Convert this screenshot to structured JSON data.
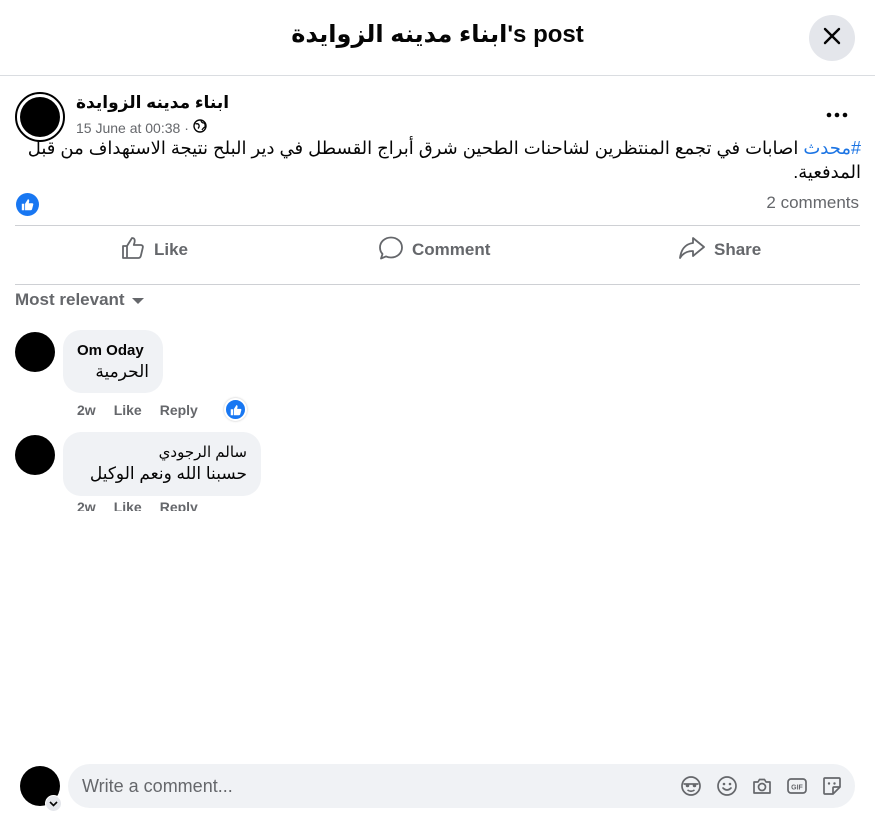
{
  "header": {
    "title": "ابناء مدينه الزوايدة's post"
  },
  "post": {
    "author": "ابناء مدينه الزوايدة",
    "timestamp": "15 June at 00:38 ·",
    "hashtag": "#محدث",
    "text": " اصابات في تجمع المنتظرين لشاحنات الطحين شرق أبراج القسطل في دير البلح نتيجة الاستهداف من قبل المدفعية.",
    "comments_count": "2 comments"
  },
  "actions": {
    "like": "Like",
    "comment": "Comment",
    "share": "Share"
  },
  "filter": {
    "label": "Most relevant"
  },
  "comments": [
    {
      "author": "Om Oday",
      "text": "الحرمية",
      "time": "2w",
      "like": "Like",
      "reply": "Reply"
    },
    {
      "author": "سالم الرجودي",
      "text": "حسبنا الله ونعم الوكيل",
      "time": "2w",
      "like": "Like",
      "reply": "Reply"
    }
  ],
  "composer": {
    "placeholder": "Write a comment..."
  },
  "colors": {
    "accent": "#1877f2",
    "hashtag": "#1b74e4",
    "secondary_text": "#65676b",
    "bubble": "#f0f2f5"
  }
}
